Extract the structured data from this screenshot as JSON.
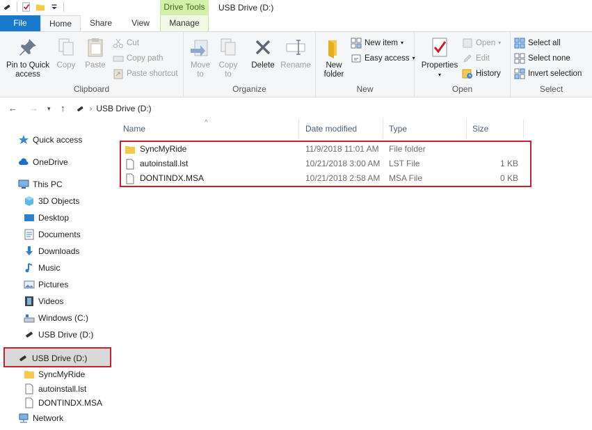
{
  "window": {
    "title": "USB Drive (D:)",
    "context_tab_group": "Drive Tools"
  },
  "tabs": {
    "file": "File",
    "home": "Home",
    "share": "Share",
    "view": "View",
    "manage": "Manage"
  },
  "ribbon": {
    "clipboard": {
      "label": "Clipboard",
      "pin_line1": "Pin to Quick",
      "pin_line2": "access",
      "copy": "Copy",
      "paste": "Paste",
      "cut": "Cut",
      "copy_path": "Copy path",
      "paste_shortcut": "Paste shortcut"
    },
    "organize": {
      "label": "Organize",
      "move_line1": "Move",
      "move_line2": "to",
      "copy_line1": "Copy",
      "copy_line2": "to",
      "delete": "Delete",
      "rename": "Rename"
    },
    "new": {
      "label": "New",
      "folder_line1": "New",
      "folder_line2": "folder",
      "new_item": "New item",
      "easy_access": "Easy access"
    },
    "open": {
      "label": "Open",
      "properties": "Properties",
      "open": "Open",
      "edit": "Edit",
      "history": "History"
    },
    "select": {
      "label": "Select",
      "select_all": "Select all",
      "select_none": "Select none",
      "invert_selection": "Invert selection"
    }
  },
  "address": {
    "path": "USB Drive (D:)"
  },
  "nav": {
    "quick_access": "Quick access",
    "onedrive": "OneDrive",
    "this_pc": "This PC",
    "objects3d": "3D Objects",
    "desktop": "Desktop",
    "documents": "Documents",
    "downloads": "Downloads",
    "music": "Music",
    "pictures": "Pictures",
    "videos": "Videos",
    "windows_c": "Windows (C:)",
    "usb_d": "USB Drive (D:)",
    "usb_d_selected": "USB Drive (D:)",
    "child_syncmyride": "SyncMyRide",
    "child_autoinstall": "autoinstall.lst",
    "child_dontindx": "DONTINDX.MSA",
    "network": "Network"
  },
  "columns": {
    "name": "Name",
    "date": "Date modified",
    "type": "Type",
    "size": "Size"
  },
  "files": [
    {
      "name": "SyncMyRide",
      "date": "11/9/2018 11:01 AM",
      "type": "File folder",
      "size": "",
      "icon": "folder-icon"
    },
    {
      "name": "autoinstall.lst",
      "date": "10/21/2018 3:00 AM",
      "type": "LST File",
      "size": "1 KB",
      "icon": "file-icon"
    },
    {
      "name": "DONTINDX.MSA",
      "date": "10/21/2018 2:58 AM",
      "type": "MSA File",
      "size": "0 KB",
      "icon": "file-icon"
    }
  ],
  "colors": {
    "file_tab": "#1979ca",
    "context_tab": "#d3f0a8",
    "highlight": "#c8202e",
    "folder": "#f6c94c"
  }
}
